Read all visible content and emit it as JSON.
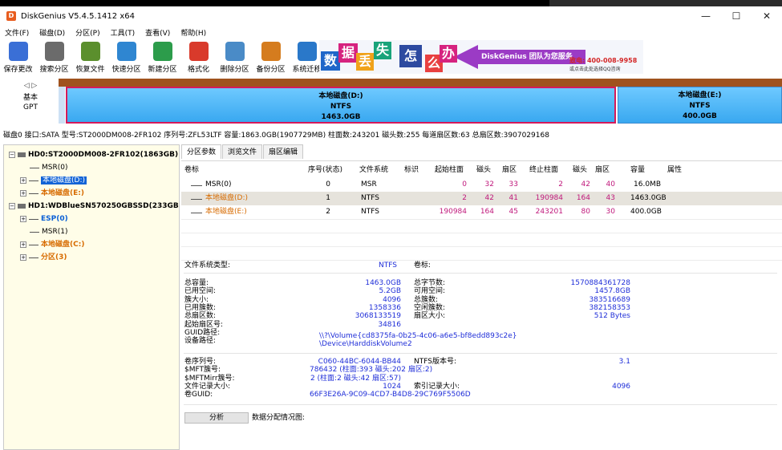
{
  "app": {
    "title": "DiskGenius V5.4.5.1412 x64",
    "icon": "D"
  },
  "window_buttons": {
    "minimize": "—",
    "maximize": "☐",
    "close": "✕"
  },
  "menu": [
    "文件(F)",
    "磁盘(D)",
    "分区(P)",
    "工具(T)",
    "查看(V)",
    "帮助(H)"
  ],
  "toolbar": [
    {
      "label": "保存更改",
      "icon": "save-icon",
      "color": "#3a6fd6"
    },
    {
      "label": "搜索分区",
      "icon": "search-icon",
      "color": "#6b6b6b"
    },
    {
      "label": "恢复文件",
      "icon": "recover-icon",
      "color": "#5b8f2d"
    },
    {
      "label": "快速分区",
      "icon": "quick-partition-icon",
      "color": "#2f86d1"
    },
    {
      "label": "新建分区",
      "icon": "new-partition-icon",
      "color": "#2c9c4b"
    },
    {
      "label": "格式化",
      "icon": "format-icon",
      "color": "#d93a2b"
    },
    {
      "label": "删除分区",
      "icon": "delete-icon",
      "color": "#4a8bc7"
    },
    {
      "label": "备份分区",
      "icon": "backup-icon",
      "color": "#d57c1e"
    },
    {
      "label": "系统迁移",
      "icon": "migrate-icon",
      "color": "#2a78c9"
    }
  ],
  "banner": {
    "tiles": [
      "数",
      "据",
      "丢",
      "失",
      "怎",
      "么",
      "办"
    ],
    "tile_colors": [
      "#1f66c9",
      "#d6237f",
      "#f0a21a",
      "#19a37a",
      "#2d4aa0",
      "#e84040",
      "#d6237f"
    ],
    "slogan": "DiskGenius 团队为您服务",
    "phone": "致电: 400-008-9958",
    "sub": "或点击此处选择QQ咨询"
  },
  "disk_nav": {
    "arrows": "◁ ▷",
    "type1": "基本",
    "type2": "GPT"
  },
  "disk_map": [
    {
      "name": "",
      "fs": "",
      "size": ""
    },
    {
      "name": "本地磁盘(D:)",
      "fs": "NTFS",
      "size": "1463.0GB"
    },
    {
      "name": "本地磁盘(E:)",
      "fs": "NTFS",
      "size": "400.0GB"
    }
  ],
  "disk_info": "磁盘0 接口:SATA 型号:ST2000DM008-2FR102 序列号:ZFL53LTF 容量:1863.0GB(1907729MB) 柱面数:243201 磁头数:255 每道扇区数:63 总扇区数:3907029168",
  "tree": [
    {
      "label": "HD0:ST2000DM008-2FR102(1863GB)",
      "kind": "disk",
      "indent": 0,
      "expander": "−"
    },
    {
      "label": "MSR(0)",
      "kind": "part",
      "indent": 1,
      "style": "black",
      "expander": ""
    },
    {
      "label": "本地磁盘(D:)",
      "kind": "part",
      "indent": 1,
      "style": "selected",
      "expander": "+"
    },
    {
      "label": "本地磁盘(E:)",
      "kind": "part",
      "indent": 1,
      "style": "orange",
      "expander": "+"
    },
    {
      "label": "HD1:WDBlueSN570250GBSSD(233GB)",
      "kind": "disk",
      "indent": 0,
      "expander": "−"
    },
    {
      "label": "ESP(0)",
      "kind": "part",
      "indent": 1,
      "style": "blue",
      "expander": "+"
    },
    {
      "label": "MSR(1)",
      "kind": "part",
      "indent": 1,
      "style": "black",
      "expander": ""
    },
    {
      "label": "本地磁盘(C:)",
      "kind": "part",
      "indent": 1,
      "style": "orange",
      "expander": "+"
    },
    {
      "label": "分区(3)",
      "kind": "part",
      "indent": 1,
      "style": "orange",
      "expander": "+"
    }
  ],
  "tabs": [
    "分区参数",
    "浏览文件",
    "扇区编辑"
  ],
  "table": {
    "headers": [
      "卷标",
      "序号(状态)",
      "文件系统",
      "标识",
      "起始柱面",
      "磁头",
      "扇区",
      "终止柱面",
      "磁头",
      "扇区",
      "容量",
      "属性"
    ],
    "rows": [
      [
        "MSR(0)",
        "0",
        "MSR",
        "",
        "0",
        "32",
        "33",
        "2",
        "42",
        "40",
        "16.0MB",
        ""
      ],
      [
        "本地磁盘(D:)",
        "1",
        "NTFS",
        "",
        "2",
        "42",
        "41",
        "190984",
        "164",
        "43",
        "1463.0GB",
        ""
      ],
      [
        "本地磁盘(E:)",
        "2",
        "NTFS",
        "",
        "190984",
        "164",
        "45",
        "243201",
        "80",
        "30",
        "400.0GB",
        ""
      ]
    ]
  },
  "details": {
    "fs_type_label": "文件系统类型:",
    "fs_type_value": "NTFS",
    "volume_label": "卷标:",
    "left_labels": [
      "总容量:",
      "已用空间:",
      "簇大小:",
      "已用簇数:",
      "总扇区数:",
      "起始扇区号:",
      "GUID路径:",
      "设备路径:"
    ],
    "left_values": [
      "1463.0GB",
      "5.2GB",
      "4096",
      "1358336",
      "3068133519",
      "34816",
      "",
      ""
    ],
    "right_labels": [
      "总字节数:",
      "可用空间:",
      "总簇数:",
      "空闲簇数:",
      "扇区大小:"
    ],
    "right_values": [
      "1570884361728",
      "1457.8GB",
      "383516689",
      "382158353",
      "512 Bytes"
    ],
    "guid_path": "\\\\?\\Volume{cd8375fa-0b25-4c06-a6e5-bf8edd893c2e}",
    "device_path": "\\Device\\HarddiskVolume2",
    "ntfs": {
      "labels": [
        "卷序列号:",
        "$MFT簇号:",
        "$MFTMirr簇号:",
        "文件记录大小:",
        "卷GUID:"
      ],
      "values": [
        "C060-44BC-6044-BB44",
        "786432 (柱面:393 磁头:202 扇区:2)",
        "2 (柱面:2 磁头:42 扇区:57)",
        "1024",
        "66F3E26A-9C09-4CD7-B4D8-29C769F5506D"
      ],
      "version_label": "NTFS版本号:",
      "version_value": "3.1",
      "index_label": "索引记录大小:",
      "index_value": "4096"
    },
    "analyze_button": "分析",
    "analyze_label": "数据分配情况图:"
  }
}
